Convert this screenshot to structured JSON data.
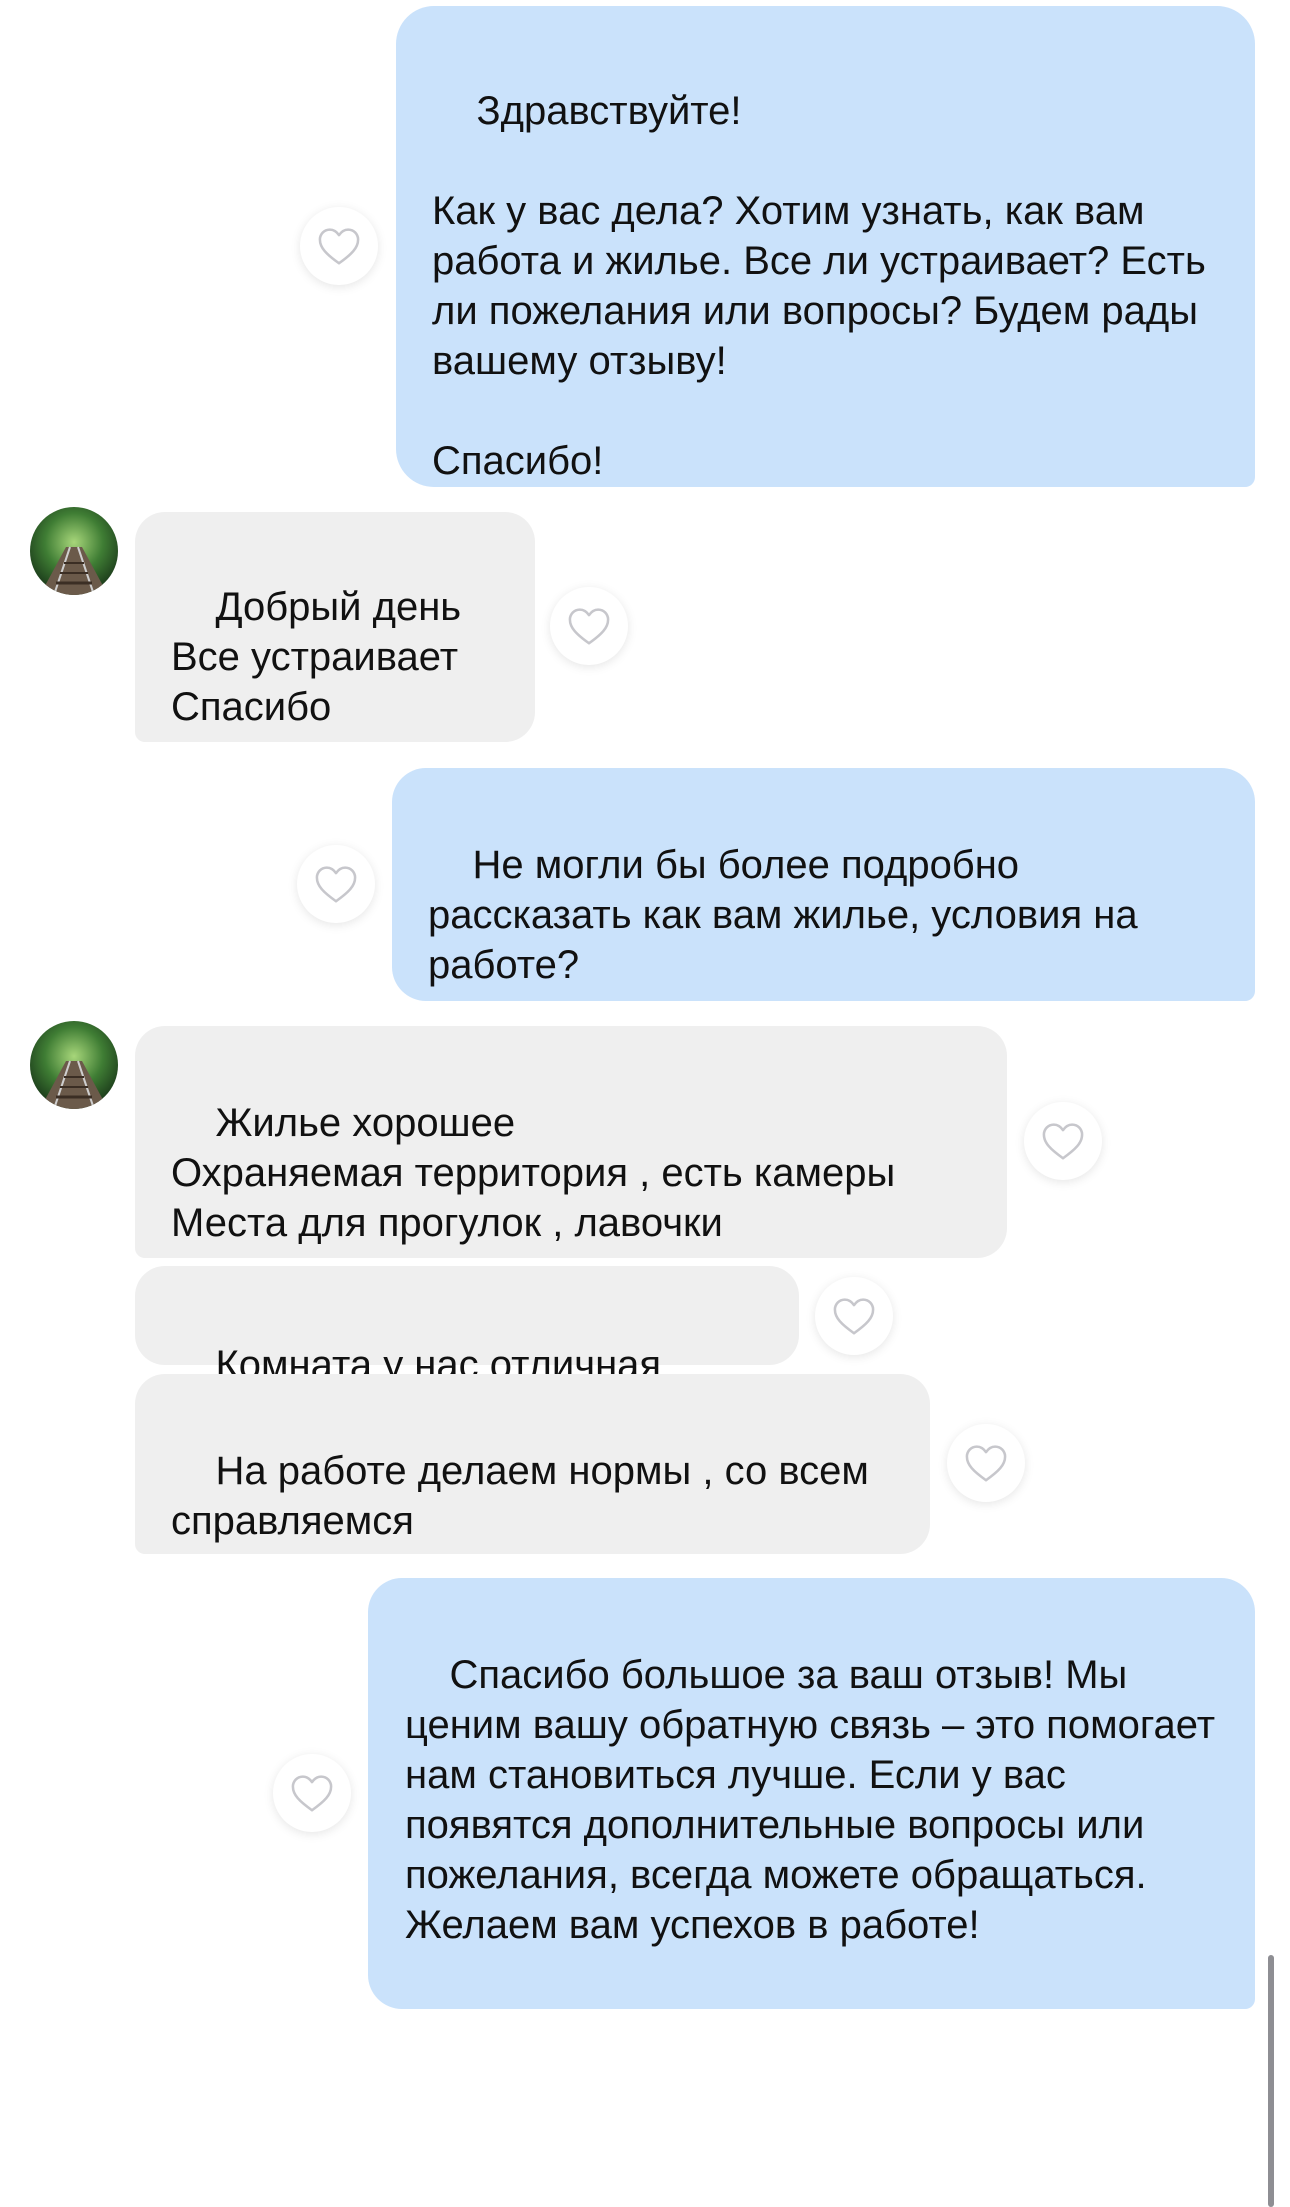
{
  "messages": [
    {
      "direction": "outgoing",
      "text": "Здравствуйте!\n\nКак у вас дела? Хотим узнать, как вам работа и жилье. Все ли устраивает? Есть ли пожелания или вопросы? Будем рады вашему отзыву!\n\nСпасибо!"
    },
    {
      "direction": "incoming",
      "text": "Добрый день\nВсе устраивает\nСпасибо"
    },
    {
      "direction": "outgoing",
      "text": "Не могли бы более подробно рассказать как вам жилье, условия на работе?"
    },
    {
      "direction": "incoming",
      "text": "Жилье хорошее\nОхраняемая территория , есть камеры\nМеста для прогулок , лавочки"
    },
    {
      "direction": "incoming",
      "text": "Комната у нас отличная"
    },
    {
      "direction": "incoming",
      "text": "На работе делаем нормы , со всем справляемся"
    },
    {
      "direction": "outgoing",
      "text": "Спасибо большое за ваш отзыв! Мы ценим вашу обратную связь – это помогает нам становиться лучше. Если у вас появятся дополнительные вопросы или пожелания, всегда можете обращаться. Желаем вам успехов в работе!"
    }
  ],
  "icons": {
    "like": "heart-outline-icon",
    "avatar": "avatar-railway-forest"
  },
  "colors": {
    "outgoing_bubble": "#cae2fb",
    "incoming_bubble": "#efefef",
    "heart_outline": "#c7c7cc",
    "text": "#111111"
  }
}
